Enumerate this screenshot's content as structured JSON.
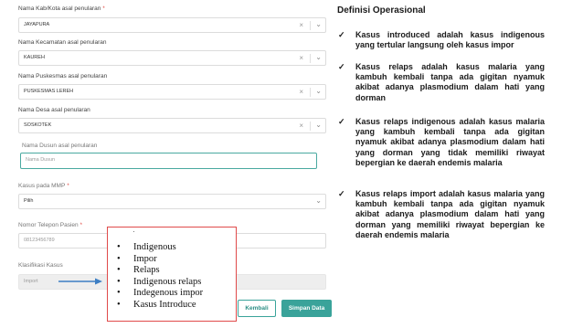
{
  "form": {
    "fields": [
      {
        "label": "Nama Kab/Kota asal penularan",
        "required": "*",
        "value": "JAYAPURA"
      },
      {
        "label": "Nama Kecamatan asal penularan",
        "value": "KAUREH"
      },
      {
        "label": "Nama Puskesmas asal penularan",
        "value": "PUSKESMAS LEREH"
      },
      {
        "label": "Nama Desa asal penularan",
        "value": "SOSKOTEK"
      }
    ],
    "clear_glyph": "×",
    "chevron_glyph": "⌄",
    "dusun": {
      "label": "Nama Dusun asal penularan",
      "placeholder": "Nama Dusun"
    },
    "mmp": {
      "label": "Kasus pada MMP",
      "required": "*",
      "value": "Pilih"
    },
    "phone": {
      "label": "Nomor Telepon Pasien",
      "required": "*",
      "placeholder": "08123456789"
    },
    "klasifikasi": {
      "label": "Klasifikasi Kasus",
      "value": "Import"
    },
    "buttons": {
      "back": "Kembali",
      "save": "Simpan Data"
    }
  },
  "dropdown_popup": {
    "top_mark": "·",
    "bullet": "•",
    "options": [
      "Indigenous",
      "Impor",
      "Relaps",
      "Indigenous relaps",
      "Indegenous impor",
      "Kasus Introduce"
    ]
  },
  "definitions": {
    "title": "Definisi Operasional",
    "check_glyph": "✓",
    "items": [
      "Kasus introduced adalah kasus indigenous yang tertular langsung oleh kasus impor",
      "Kasus relaps adalah kasus malaria yang kambuh kembali tanpa ada gigitan nyamuk akibat adanya plasmodium dalam hati yang dorman",
      "Kasus relaps indigenous adalah kasus malaria yang kambuh kembali tanpa ada gigitan nyamuk akibat adanya plasmodium dalam hati yang dorman yang tidak memiliki riwayat bepergian ke daerah endemis malaria",
      "Kasus relaps import adalah kasus malaria yang kambuh kembali tanpa ada gigitan nyamuk akibat adanya plasmodium dalam hati yang dorman yang memiliki riwayat bepergian ke daerah endemis malaria"
    ]
  },
  "colors": {
    "accent": "#3aa39a",
    "popup_border": "#e04a4a",
    "arrow": "#3d7fc4"
  }
}
